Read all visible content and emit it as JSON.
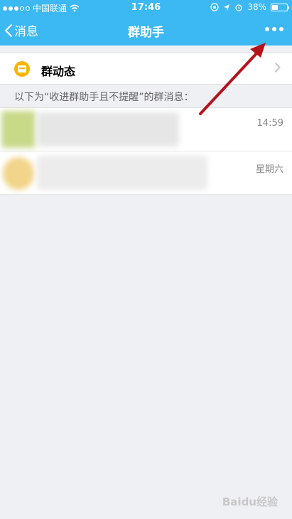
{
  "status": {
    "carrier": "中国联通",
    "time": "17:46",
    "battery": "38%",
    "battery_level": 0.38
  },
  "nav": {
    "back_label": "消息",
    "title": "群助手"
  },
  "group_dynamic": {
    "label": "群动态"
  },
  "section_note": "以下为“收进群助手且不提醒”的群消息：",
  "messages": [
    {
      "time": "14:59"
    },
    {
      "time": "星期六"
    }
  ],
  "watermark": "Baidu经验",
  "colors": {
    "nav_bg": "#3cb8f3",
    "arrow": "#b5121b",
    "icon_yellow": "#f8b500"
  }
}
